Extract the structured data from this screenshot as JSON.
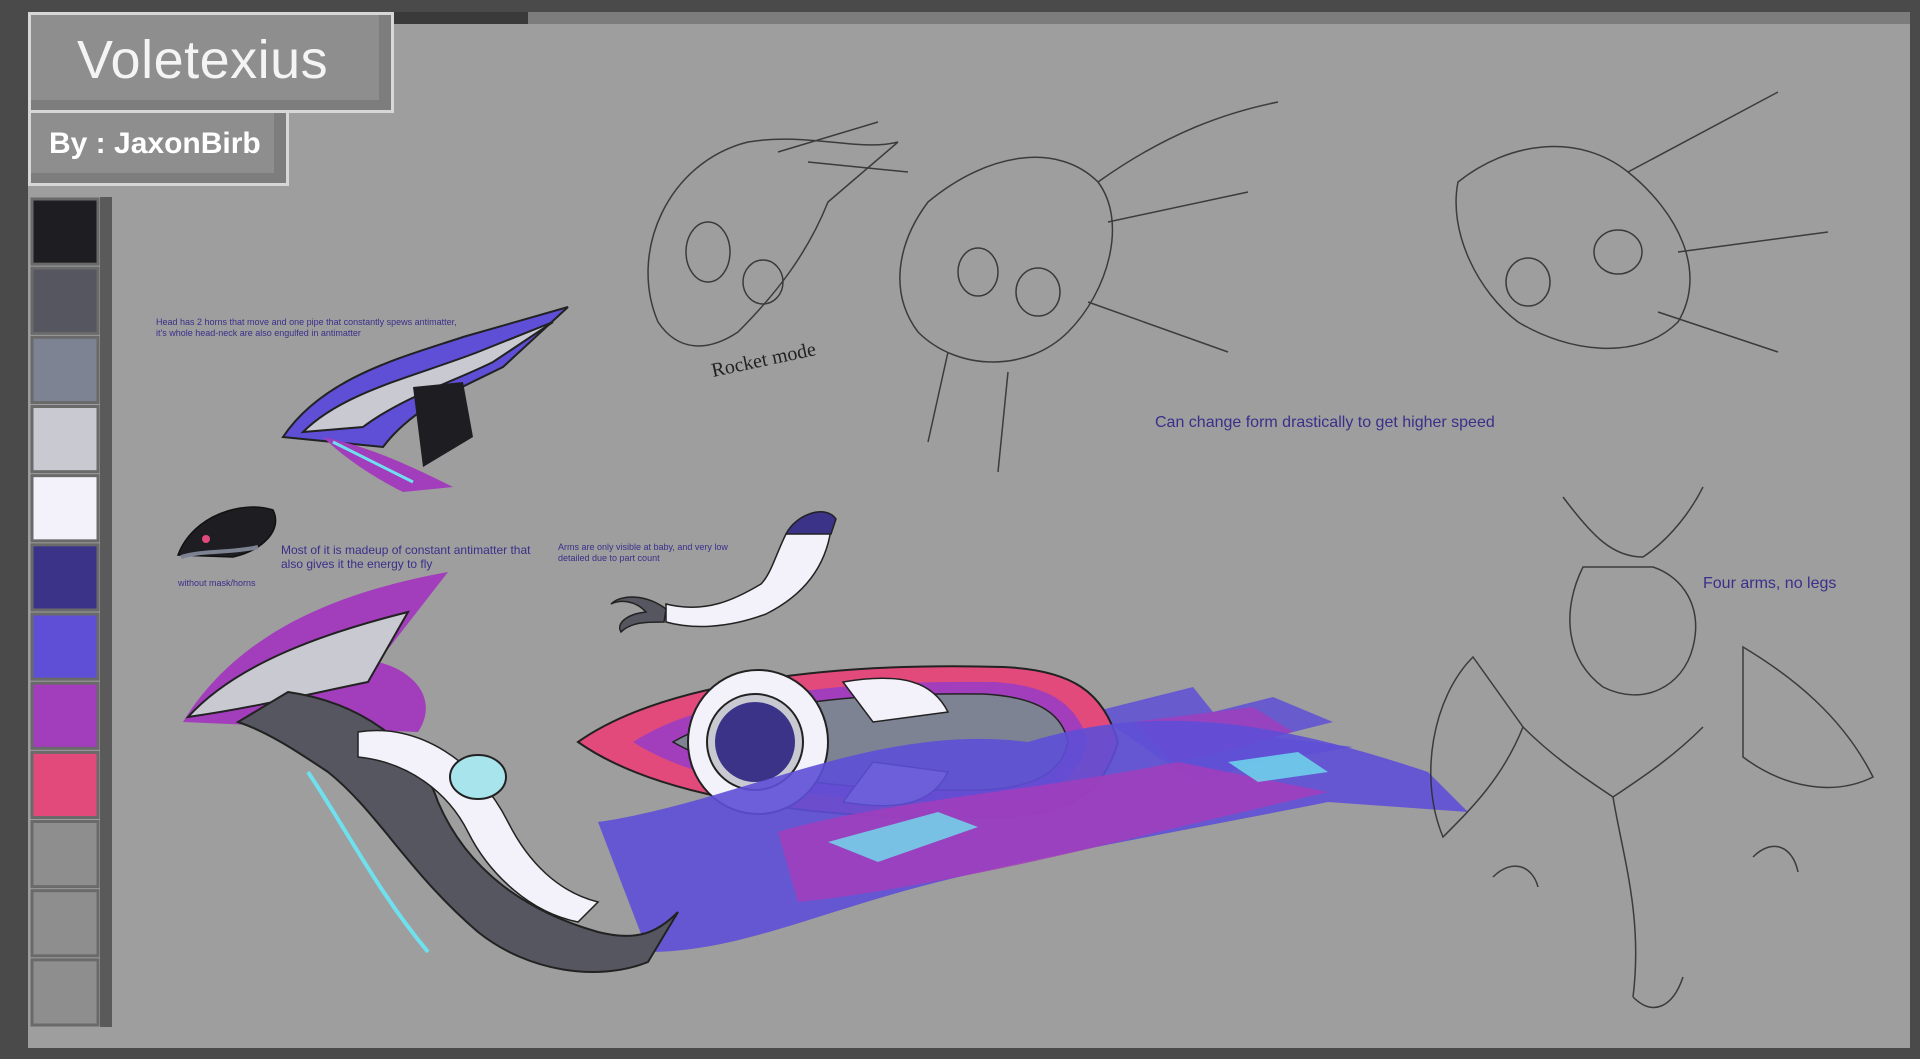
{
  "title": "Voletexius",
  "author": "By : JaxonBirb",
  "palette": [
    "#1e1e22",
    "#55565f",
    "#7e8394",
    "#c9c9d2",
    "#f3f2fa",
    "#3b3388",
    "#5e4fd6",
    "#a23dbb",
    "#e34a7c",
    "#8e8e8e",
    "#8e8e8e",
    "#8e8e8e"
  ],
  "notes": {
    "head": "Head has 2 horns that move and one pipe that constantly spews antimatter, it's whole head-neck are also engulfed in antimatter",
    "without_mask": "without mask/horns",
    "antimatter": "Most of it is madeup of constant antimatter that also gives it the energy to fly",
    "arms": "Arms are only visible at baby, and very low detailed due to part count",
    "rocket": "Rocket mode",
    "form": "Can change form drastically to get higher speed",
    "four_arms": "Four arms, no legs"
  }
}
